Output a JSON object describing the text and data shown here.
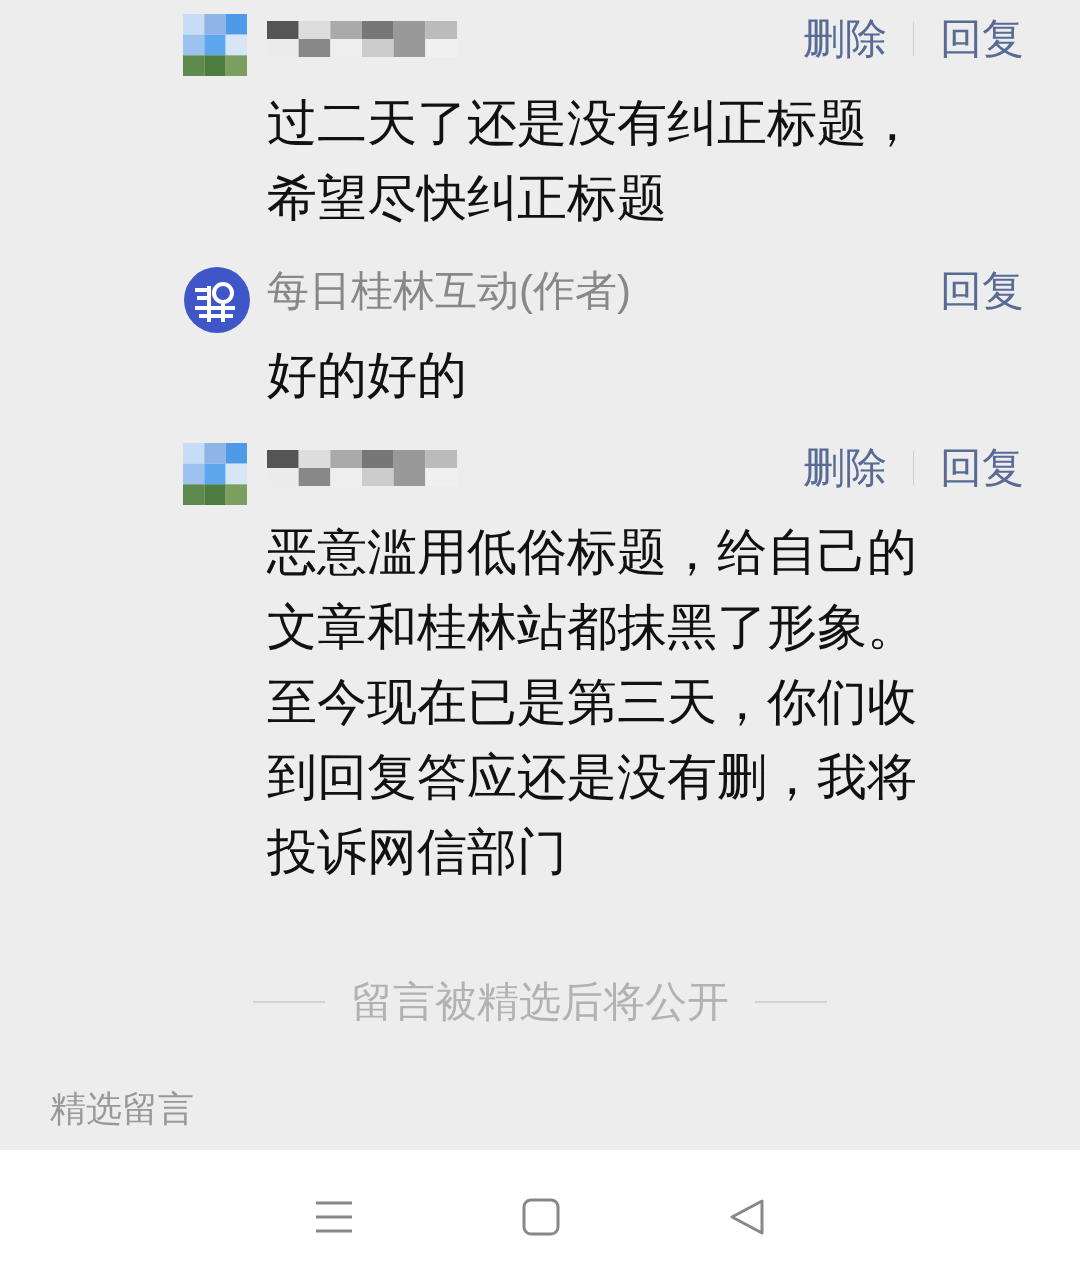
{
  "comments": [
    {
      "kind": "masked",
      "actions": [
        "删除",
        "回复"
      ],
      "text": "过二天了还是没有纠正标题，希望尽快纠正标题"
    },
    {
      "kind": "author",
      "author": "每日桂林互动(作者)",
      "actions": [
        "回复"
      ],
      "text": "好的好的"
    },
    {
      "kind": "masked",
      "actions": [
        "删除",
        "回复"
      ],
      "text": "恶意滥用低俗标题，给自己的文章和桂林站都抹黑了形象。至今现在已是第三天，你们收到回复答应还是没有删，我将投诉网信部门"
    }
  ],
  "notice": "留言被精选后将公开",
  "section_title": "精选留言",
  "nav_bar": {
    "buttons": [
      {
        "kind": "menu"
      },
      {
        "kind": "home"
      },
      {
        "kind": "back"
      }
    ]
  }
}
